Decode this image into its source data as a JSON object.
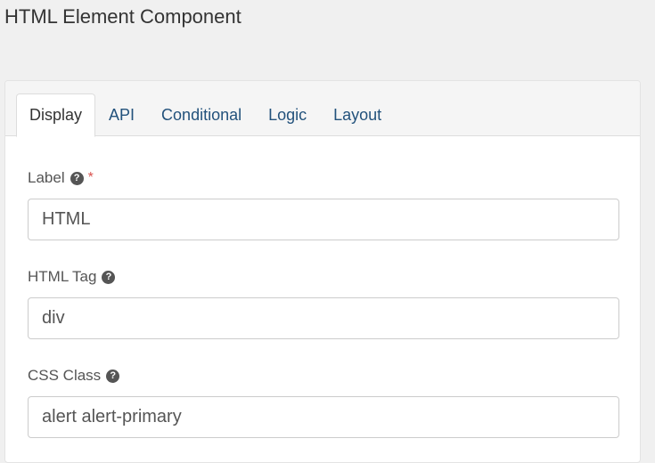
{
  "page": {
    "title": "HTML Element Component"
  },
  "tabs": [
    {
      "label": "Display",
      "active": true
    },
    {
      "label": "API",
      "active": false
    },
    {
      "label": "Conditional",
      "active": false
    },
    {
      "label": "Logic",
      "active": false
    },
    {
      "label": "Layout",
      "active": false
    }
  ],
  "form": {
    "label_field": {
      "label": "Label",
      "required_mark": "*",
      "help_icon": "question-circle-icon",
      "value": "HTML"
    },
    "tag_field": {
      "label": "HTML Tag",
      "help_icon": "question-circle-icon",
      "value": "div"
    },
    "class_field": {
      "label": "CSS Class",
      "help_icon": "question-circle-icon",
      "value": "alert alert-primary"
    }
  },
  "colors": {
    "link": "#23527c",
    "required": "#d9534f",
    "background": "#f0f0f0"
  }
}
